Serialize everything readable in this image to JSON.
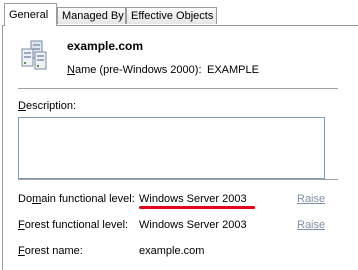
{
  "tabs": [
    {
      "label": "General",
      "active": true
    },
    {
      "label": "Managed By",
      "active": false
    },
    {
      "label": "Effective Objects",
      "active": false
    }
  ],
  "domain": {
    "name": "example.com",
    "icon": "domain-icon"
  },
  "netbios": {
    "label_prefix": "N",
    "label_rest": "ame (pre-Windows 2000):",
    "value": "EXAMPLE"
  },
  "description": {
    "label_prefix": "D",
    "label_rest": "escription:",
    "value": ""
  },
  "domain_level": {
    "label_pre": "Do",
    "label_ul": "m",
    "label_rest": "ain functional level:",
    "value": "Windows Server 2003",
    "action": "Raise"
  },
  "forest_level": {
    "label_prefix": "F",
    "label_rest": "orest functional level:",
    "value": "Windows Server 2003",
    "action": "Raise"
  },
  "forest_name": {
    "label_prefix": "F",
    "label_rest": "orest name:",
    "value": "example.com"
  },
  "colors": {
    "highlight": "#e3001b",
    "link": "#7f8fa8",
    "border": "#9c9c9c"
  }
}
